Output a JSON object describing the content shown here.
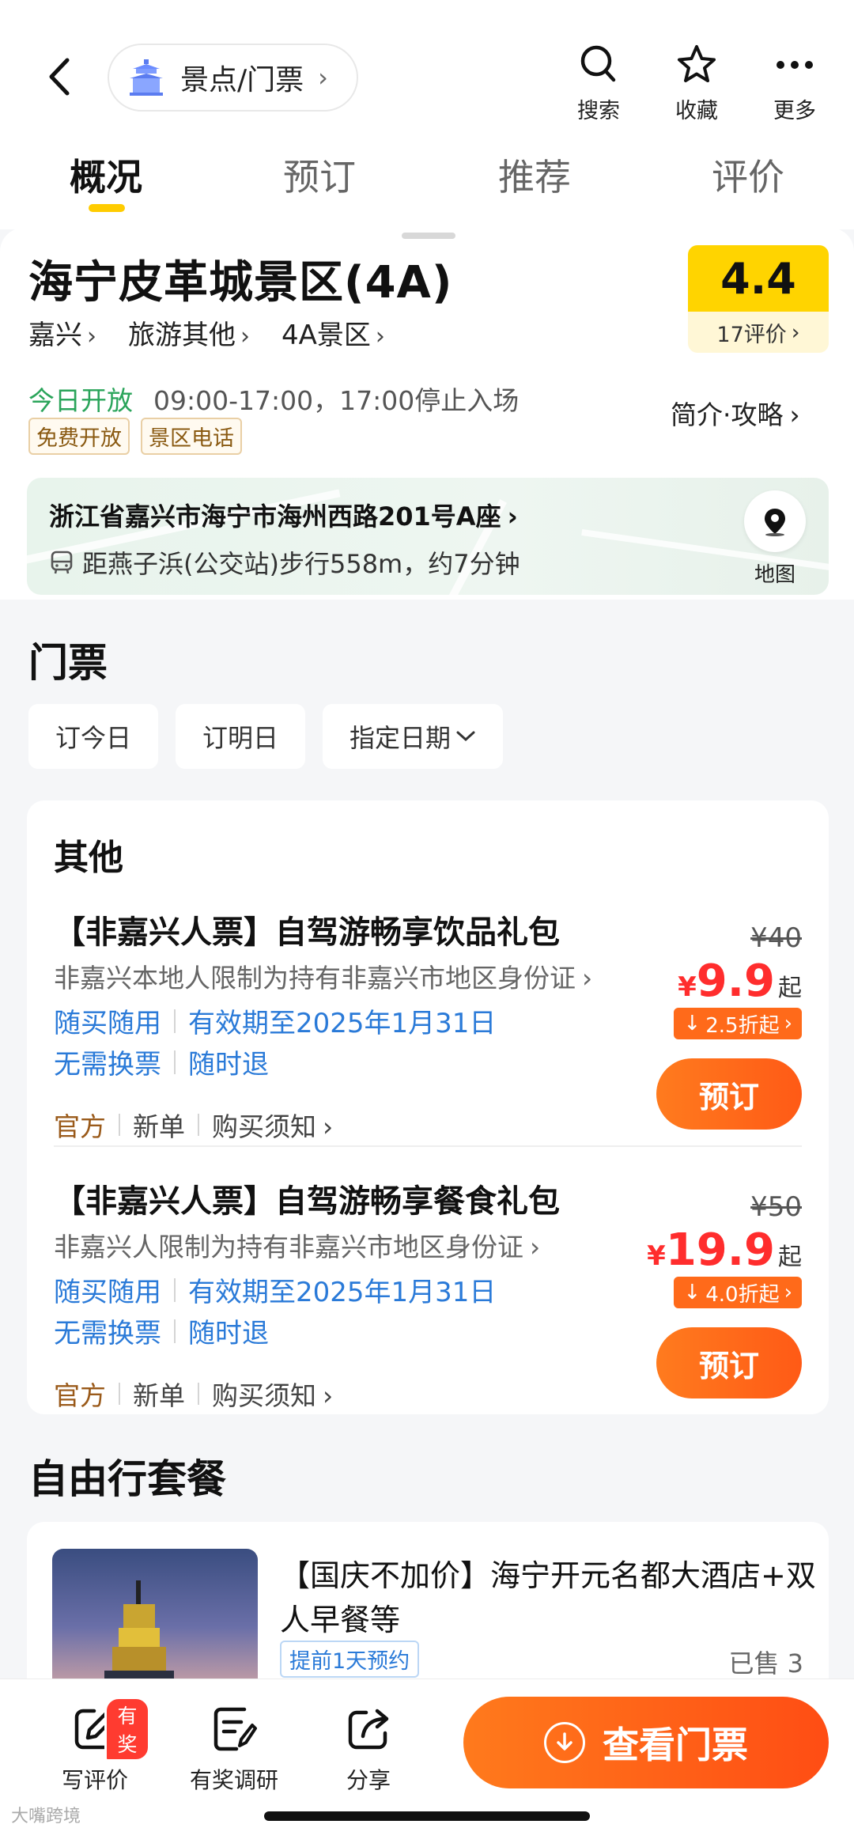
{
  "nav": {
    "category": "景点/门票",
    "actions": [
      {
        "label": "搜索",
        "icon": "search-icon"
      },
      {
        "label": "收藏",
        "icon": "star-icon"
      },
      {
        "label": "更多",
        "icon": "more-icon"
      }
    ]
  },
  "tabs": [
    "概况",
    "预订",
    "推荐",
    "评价"
  ],
  "info": {
    "title": "海宁皮革城景区(4A)",
    "crumbs": [
      "嘉兴",
      "旅游其他",
      "4A景区"
    ],
    "score": "4.4",
    "review_count": "17评价",
    "open_today": "今日开放",
    "hours": "09:00-17:00，17:00停止入场",
    "tags": [
      "免费开放",
      "景区电话"
    ],
    "intro_link": "简介·攻略",
    "address": "浙江省嘉兴市海宁市海州西路201号A座",
    "walk": "距燕子浜(公交站)步行558m，约7分钟",
    "map_label": "地图"
  },
  "tickets": {
    "section_title": "门票",
    "date_chips": [
      "订今日",
      "订明日",
      "指定日期"
    ],
    "group_title": "其他",
    "products": [
      {
        "title": "【非嘉兴人票】自驾游畅享饮品礼包",
        "desc": "非嘉兴本地人限制为持有非嘉兴市地区身份证",
        "line1a": "随买随用",
        "line1b": "有效期至2025年1月31日",
        "line2a": "无需换票",
        "line2b": "随时退",
        "official": "官方",
        "new": "新单",
        "notice": "购买须知",
        "orig_price": "¥40",
        "yen": "¥",
        "price": "9.9",
        "qi": "起",
        "discount": "2.5折起",
        "book": "预订"
      },
      {
        "title": "【非嘉兴人票】自驾游畅享餐食礼包",
        "desc": "非嘉兴人限制为持有非嘉兴市地区身份证",
        "line1a": "随买随用",
        "line1b": "有效期至2025年1月31日",
        "line2a": "无需换票",
        "line2b": "随时退",
        "official": "官方",
        "new": "新单",
        "notice": "购买须知",
        "orig_price": "¥50",
        "yen": "¥",
        "price": "19.9",
        "qi": "起",
        "discount": "4.0折起",
        "book": "预订"
      }
    ]
  },
  "package": {
    "section_title": "自由行套餐",
    "title": "【国庆不加价】海宁开元名都大酒店+双人早餐等",
    "tag": "提前1天预约",
    "sold": "已售 3"
  },
  "bottom": {
    "write_review": "写评价",
    "badge": "有奖",
    "survey": "有奖调研",
    "share": "分享",
    "cta": "查看门票"
  },
  "watermark": "大嘴跨境",
  "colors": {
    "accent_yellow": "#ffcc00",
    "price_red": "#ff2d2d",
    "cta_orange": "#ff5a16",
    "link_blue": "#2a7ad8",
    "open_green": "#2aa45a"
  }
}
